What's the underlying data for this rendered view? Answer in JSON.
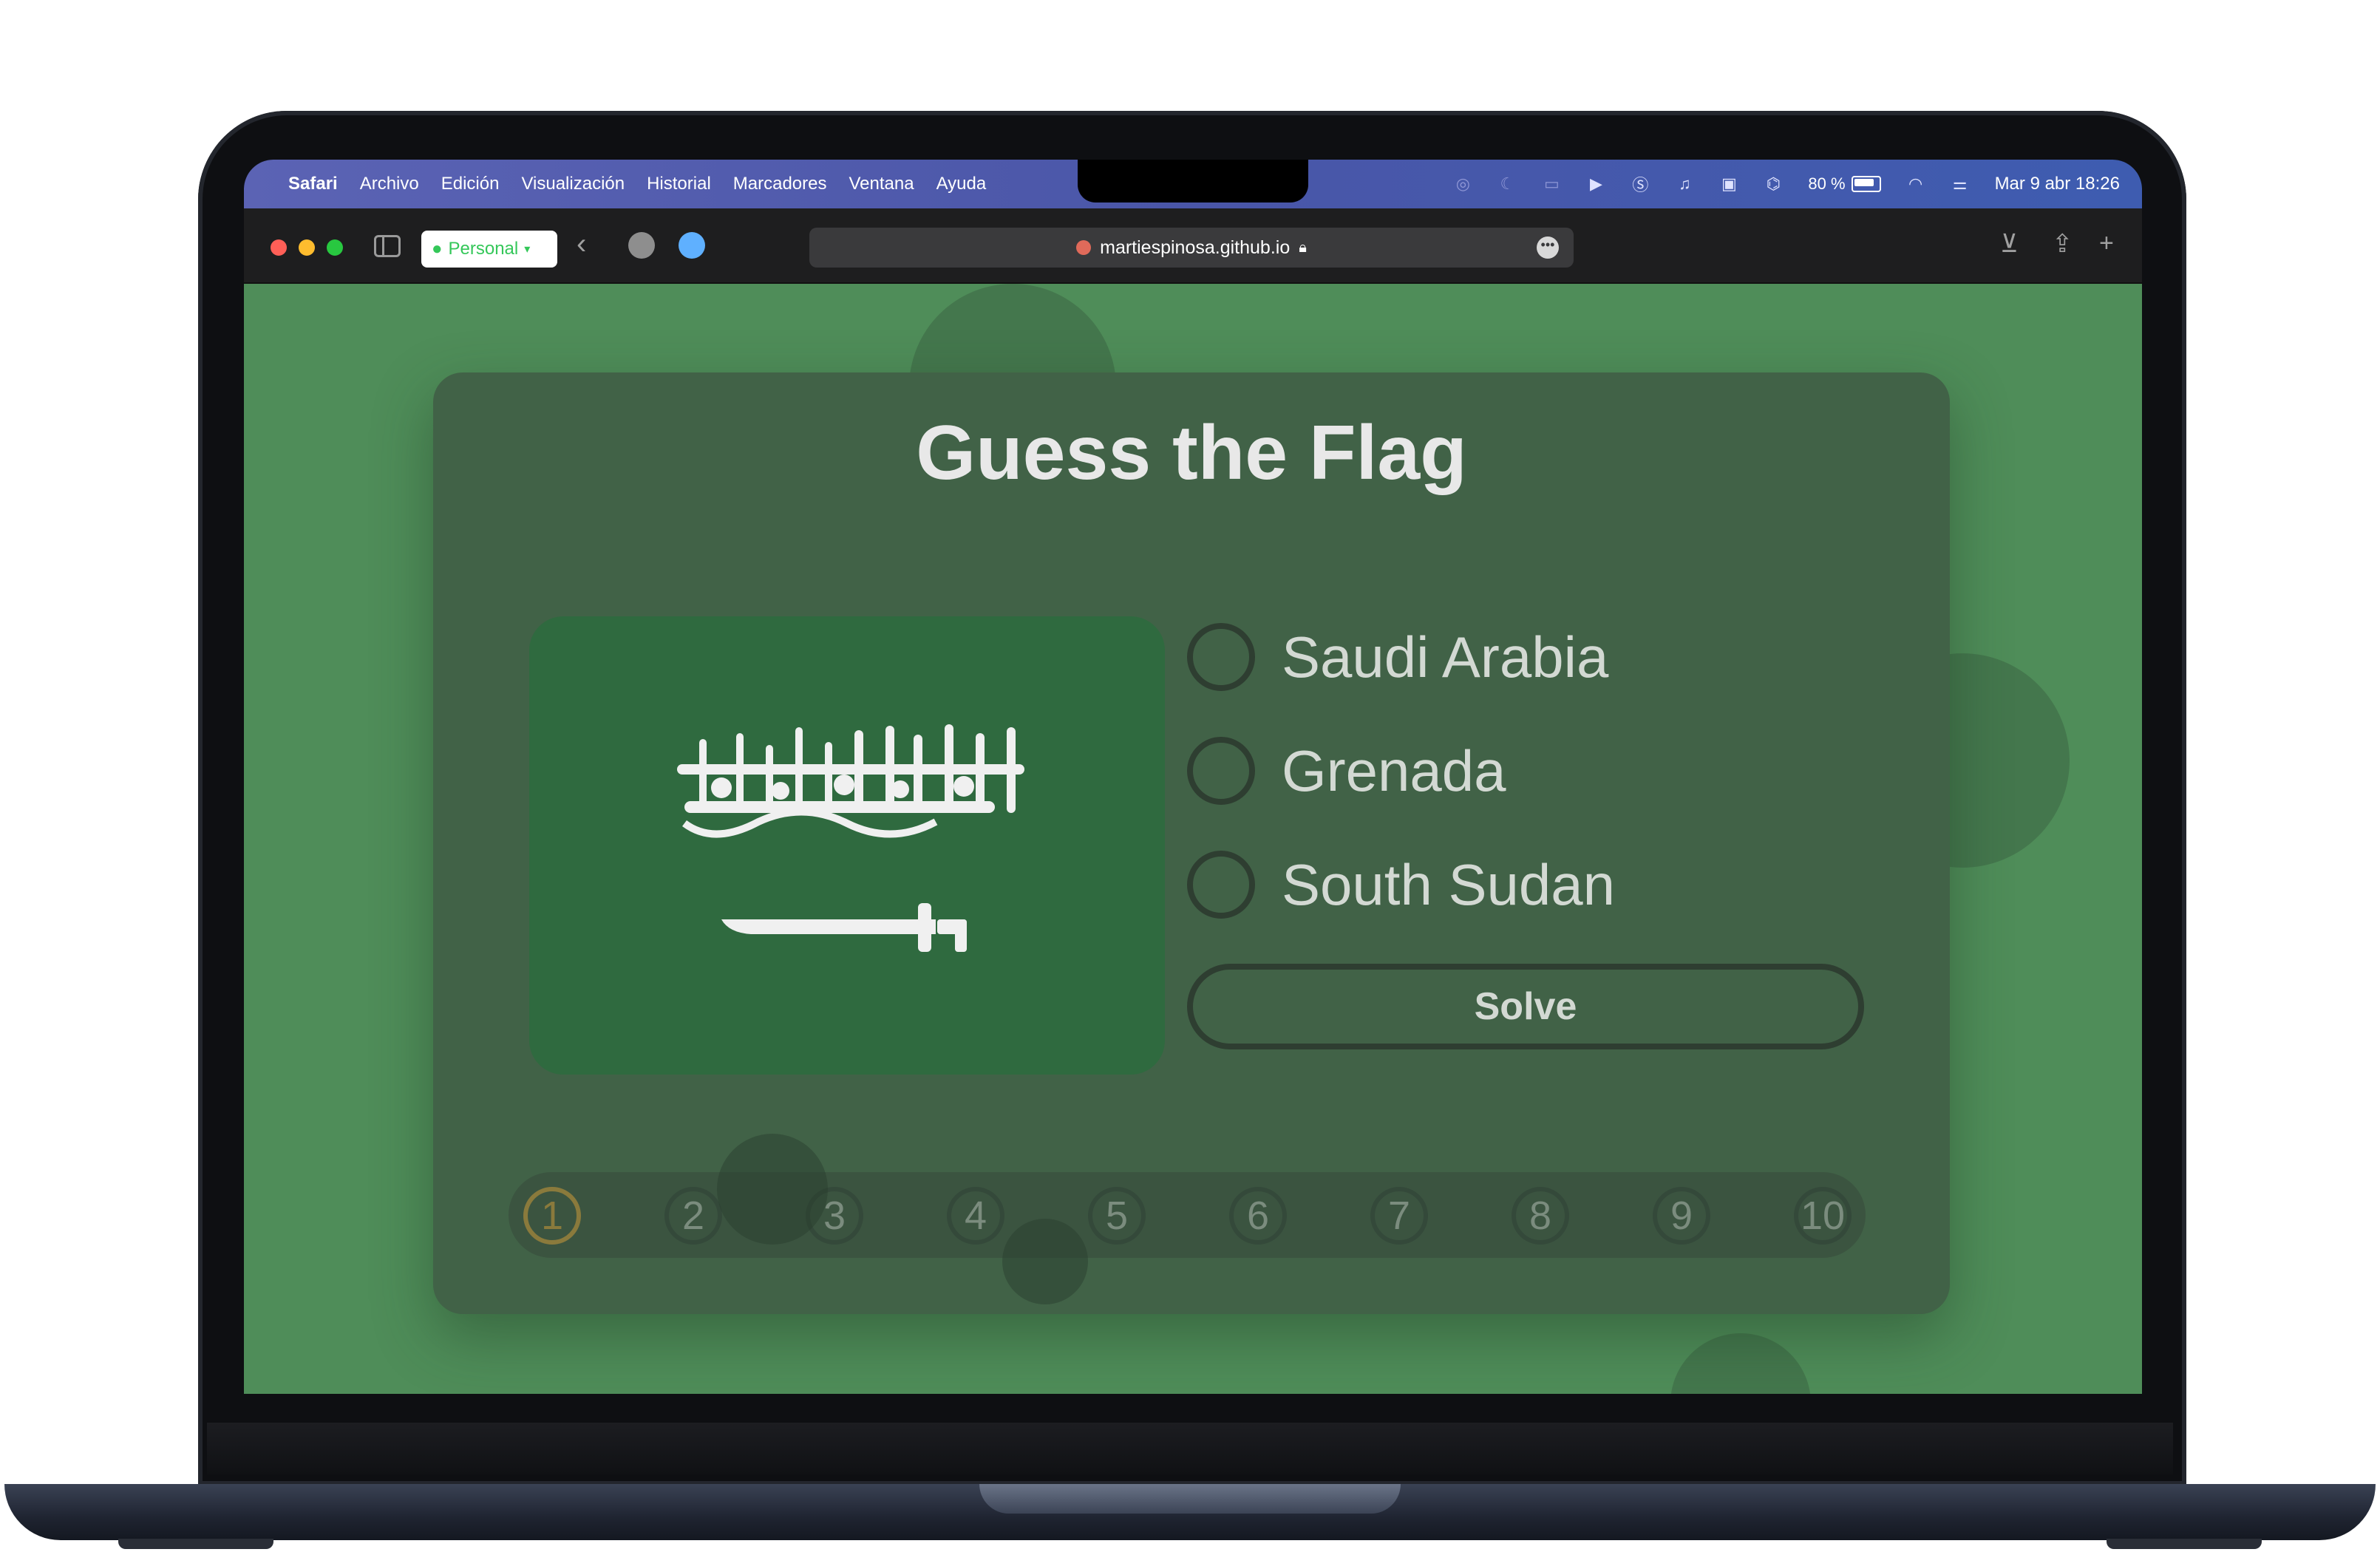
{
  "menubar": {
    "app": "Safari",
    "items": [
      "Archivo",
      "Edición",
      "Visualización",
      "Historial",
      "Marcadores",
      "Ventana",
      "Ayuda"
    ],
    "battery": "80 %",
    "datetime": "Mar 9 abr 18:26"
  },
  "toolbar": {
    "profile": "Personal",
    "url": "martiespinosa.github.io"
  },
  "quiz": {
    "title": "Guess the Flag",
    "flag_shown": "Saudi Arabia flag",
    "options": [
      "Saudi Arabia",
      "Grenada",
      "South Sudan"
    ],
    "solve_label": "Solve",
    "steps": [
      "1",
      "2",
      "3",
      "4",
      "5",
      "6",
      "7",
      "8",
      "9",
      "10"
    ],
    "current_step": 1
  },
  "colors": {
    "page_background": "#4f8d59",
    "card_background": "#416247",
    "flag_green": "#2f6a3f",
    "current_step_accent": "#8a7a3c"
  }
}
